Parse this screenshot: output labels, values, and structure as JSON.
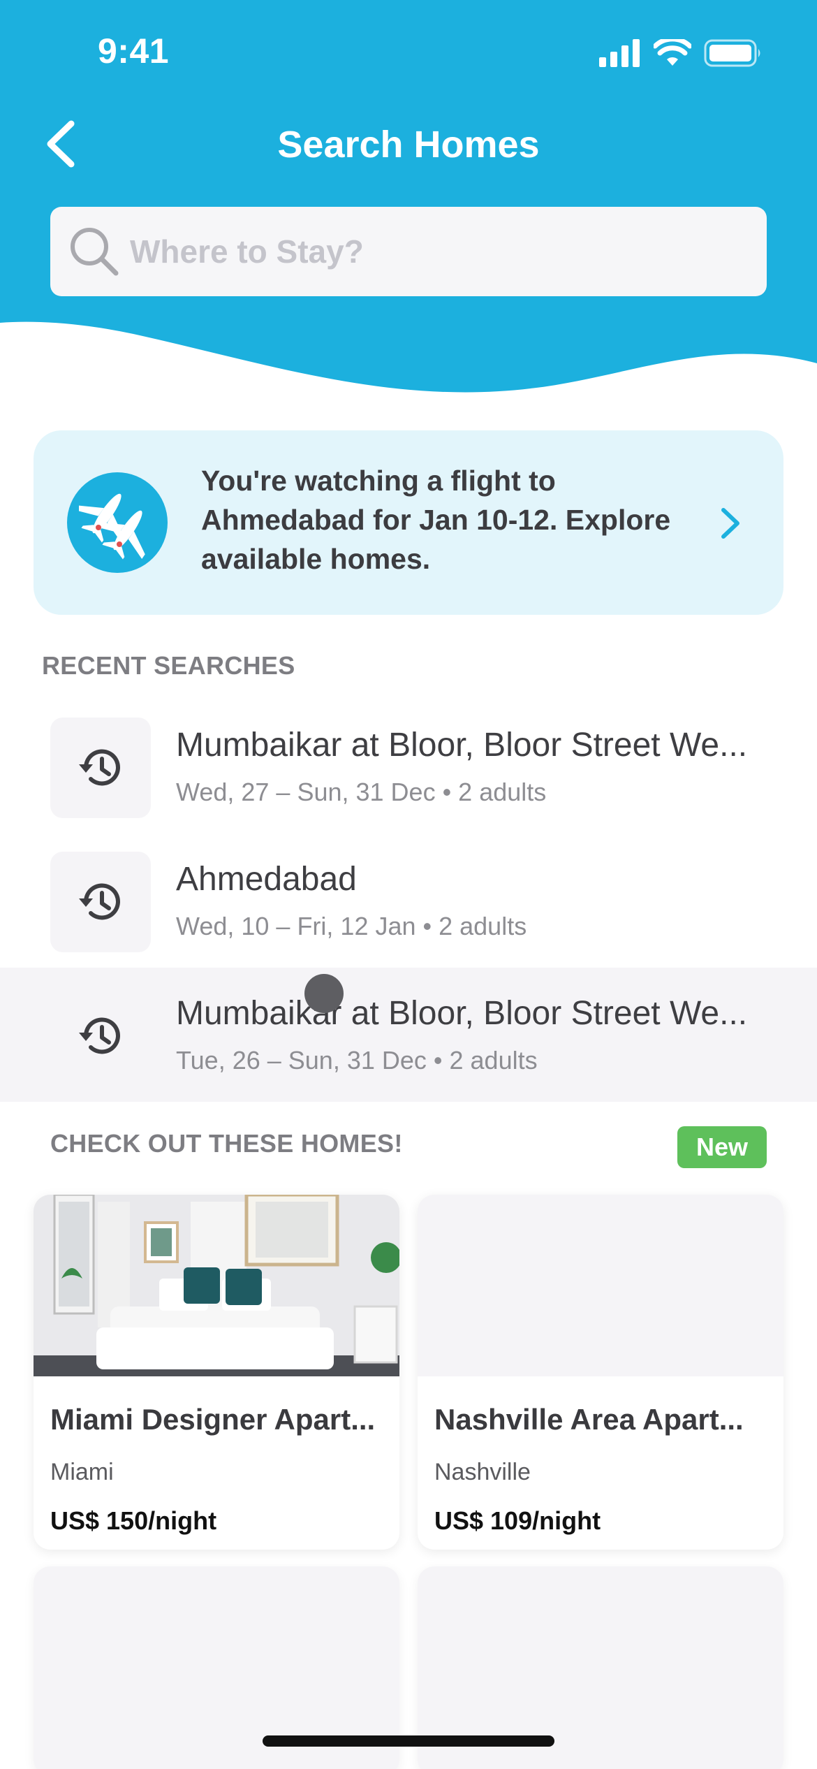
{
  "status_bar": {
    "time": "9:41"
  },
  "header": {
    "title": "Search Homes",
    "search_placeholder": "Where to Stay?",
    "accent_color": "#1cb0de"
  },
  "promo": {
    "text": "You're watching a flight to Ahmedabad for Jan 10-12. Explore available homes.",
    "icon": "airplane-icon"
  },
  "recent": {
    "label": "RECENT SEARCHES",
    "items": [
      {
        "title": "Mumbaikar at Bloor, Bloor Street We...",
        "subtitle": "Wed, 27 – Sun, 31 Dec • 2 adults"
      },
      {
        "title": "Ahmedabad",
        "subtitle": "Wed, 10 – Fri, 12 Jan • 2 adults"
      },
      {
        "title": "Mumbaikar at Bloor, Bloor Street We...",
        "subtitle": "Tue, 26 – Sun, 31 Dec • 2 adults"
      }
    ]
  },
  "homes": {
    "label": "CHECK OUT THESE HOMES!",
    "badge": "New",
    "badge_color": "#5ec05b",
    "items": [
      {
        "title": "Miami Designer Apart...",
        "city": "Miami",
        "price": "US$ 150/night"
      },
      {
        "title": "Nashville Area Apart...",
        "city": "Nashville",
        "price": "US$ 109/night"
      }
    ]
  }
}
